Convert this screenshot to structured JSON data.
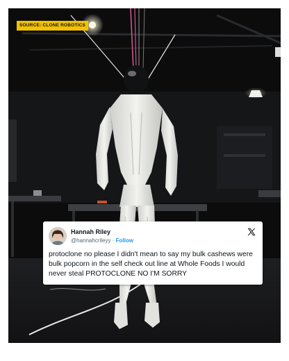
{
  "source": {
    "label": "SOURCE: CLONE ROBOTICS"
  },
  "tweet": {
    "author_name": "Hannah Riley",
    "handle": "@hannahcrileyy",
    "separator": "·",
    "follow_label": "Follow",
    "text": "protoclone no please I didn't mean to say my bulk cashews were bulk popcorn in the self check out line at Whole Foods I would never steal PROTOCLONE NO I'M SORRY",
    "platform_icon": "x-logo-icon"
  },
  "colors": {
    "badge": "#f2c200",
    "follow": "#1d9bf0",
    "background": "#0b0b0c"
  }
}
